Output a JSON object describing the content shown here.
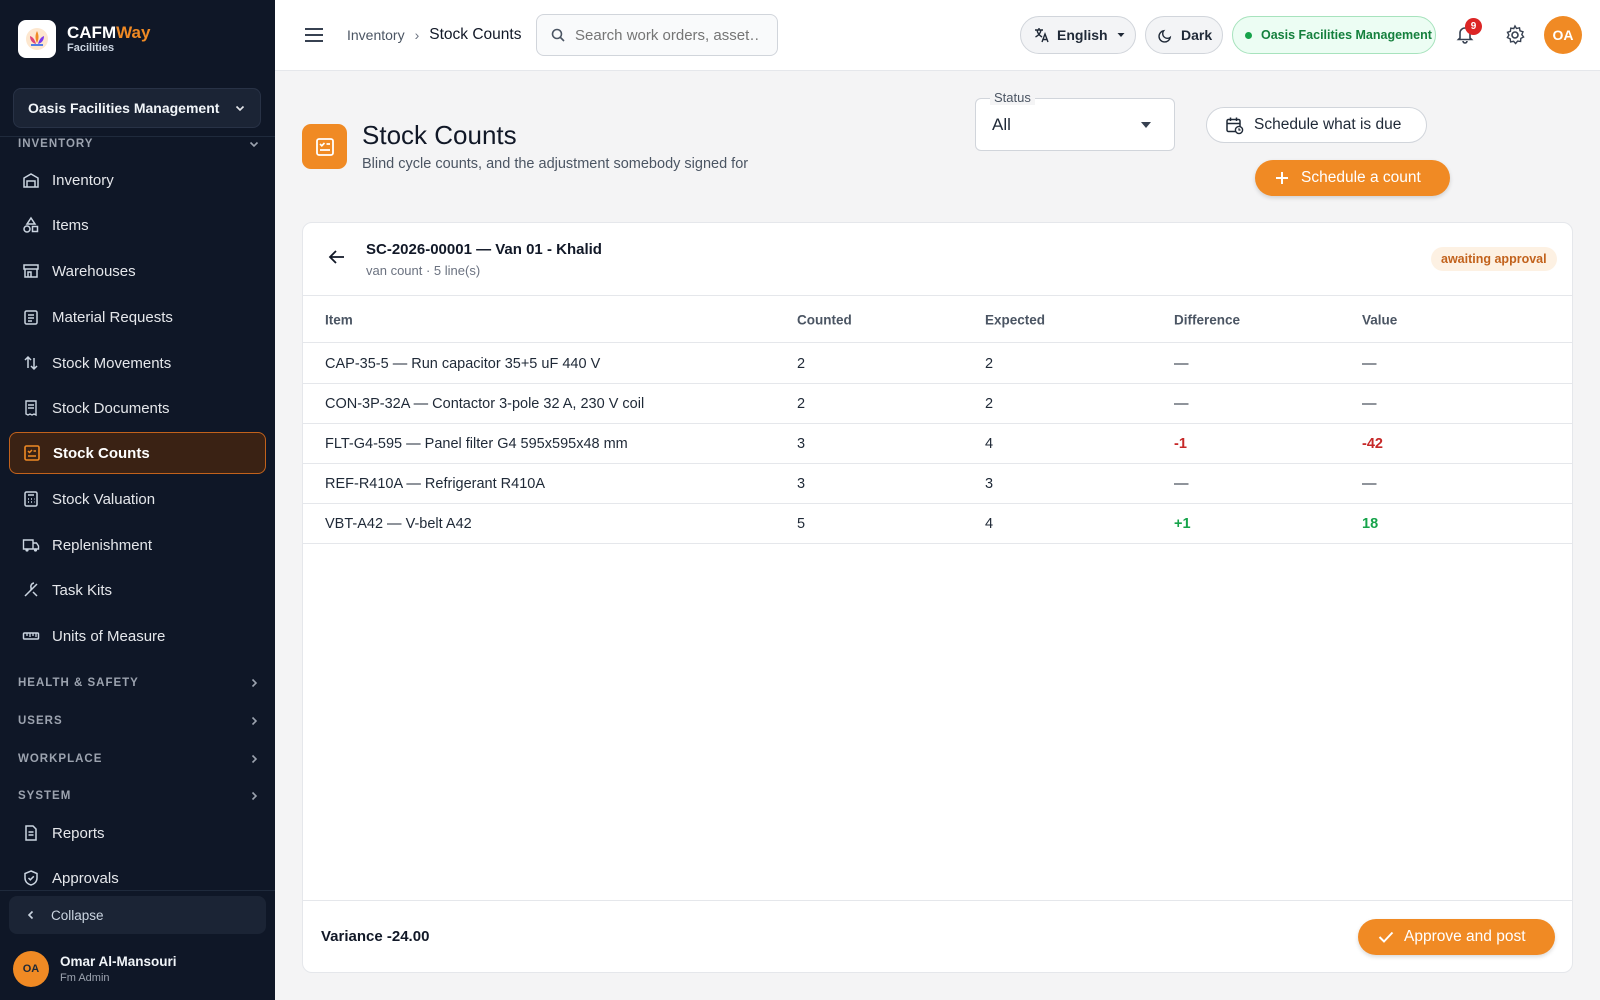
{
  "app": {
    "brand_name_main": "CAFM",
    "brand_name_accent": "Way",
    "brand_sub": "Facilities",
    "org_select": "Oasis Facilities Management"
  },
  "sidebar": {
    "inventory_section": "INVENTORY",
    "items": [
      {
        "label": "Inventory",
        "icon": "warehouse-icon"
      },
      {
        "label": "Items",
        "icon": "shapes-icon"
      },
      {
        "label": "Warehouses",
        "icon": "store-icon"
      },
      {
        "label": "Material Requests",
        "icon": "clipboard-icon"
      },
      {
        "label": "Stock Movements",
        "icon": "swap-vertical-icon"
      },
      {
        "label": "Stock Documents",
        "icon": "receipt-icon"
      },
      {
        "label": "Stock Counts",
        "icon": "checklist-icon"
      },
      {
        "label": "Stock Valuation",
        "icon": "calculator-icon"
      },
      {
        "label": "Replenishment",
        "icon": "truck-icon"
      },
      {
        "label": "Task Kits",
        "icon": "tools-icon"
      },
      {
        "label": "Units of Measure",
        "icon": "ruler-icon"
      }
    ],
    "sections": [
      "HEALTH & SAFETY",
      "USERS",
      "WORKPLACE",
      "SYSTEM"
    ],
    "system_items": [
      {
        "label": "Reports",
        "icon": "report-icon"
      },
      {
        "label": "Approvals",
        "icon": "shield-check-icon"
      }
    ],
    "collapse_label": "Collapse",
    "user": {
      "initials": "OA",
      "name": "Omar Al-Mansouri",
      "role": "Fm Admin"
    }
  },
  "topbar": {
    "breadcrumb": [
      "Inventory",
      "Stock Counts"
    ],
    "search_placeholder": "Search work orders, asset…",
    "language": "English",
    "theme": "Dark",
    "org_badge": "Oasis Facilities Management",
    "notifications_count": "9",
    "avatar_initials": "OA"
  },
  "page": {
    "title": "Stock Counts",
    "subtitle": "Blind cycle counts, and the adjustment somebody signed for",
    "status_label": "Status",
    "status_value": "All",
    "schedule_due_label": "Schedule what is due",
    "schedule_count_label": "Schedule a count"
  },
  "count": {
    "title": "SC-2026-00001 — Van 01 - Khalid",
    "subtitle": "van count · 5 line(s)",
    "status": "awaiting approval",
    "columns": [
      "Item",
      "Counted",
      "Expected",
      "Difference",
      "Value"
    ],
    "rows": [
      {
        "item": "CAP-35-5 — Run capacitor 35+5 uF 440 V",
        "counted": "2",
        "expected": "2",
        "difference": "—",
        "value": "—"
      },
      {
        "item": "CON-3P-32A — Contactor 3-pole 32 A, 230 V coil",
        "counted": "2",
        "expected": "2",
        "difference": "—",
        "value": "—"
      },
      {
        "item": "FLT-G4-595 — Panel filter G4 595x595x48 mm",
        "counted": "3",
        "expected": "4",
        "difference": "-1",
        "value": "-42"
      },
      {
        "item": "REF-R410A — Refrigerant R410A",
        "counted": "3",
        "expected": "3",
        "difference": "—",
        "value": "—"
      },
      {
        "item": "VBT-A42 — V-belt A42",
        "counted": "5",
        "expected": "4",
        "difference": "+1",
        "value": "18"
      }
    ],
    "variance": "Variance -24.00",
    "approve_label": "Approve and post"
  },
  "colors": {
    "accent": "#f08a24",
    "sidebar_bg": "#0f1727",
    "negative": "#c62828",
    "positive": "#16a34a"
  }
}
